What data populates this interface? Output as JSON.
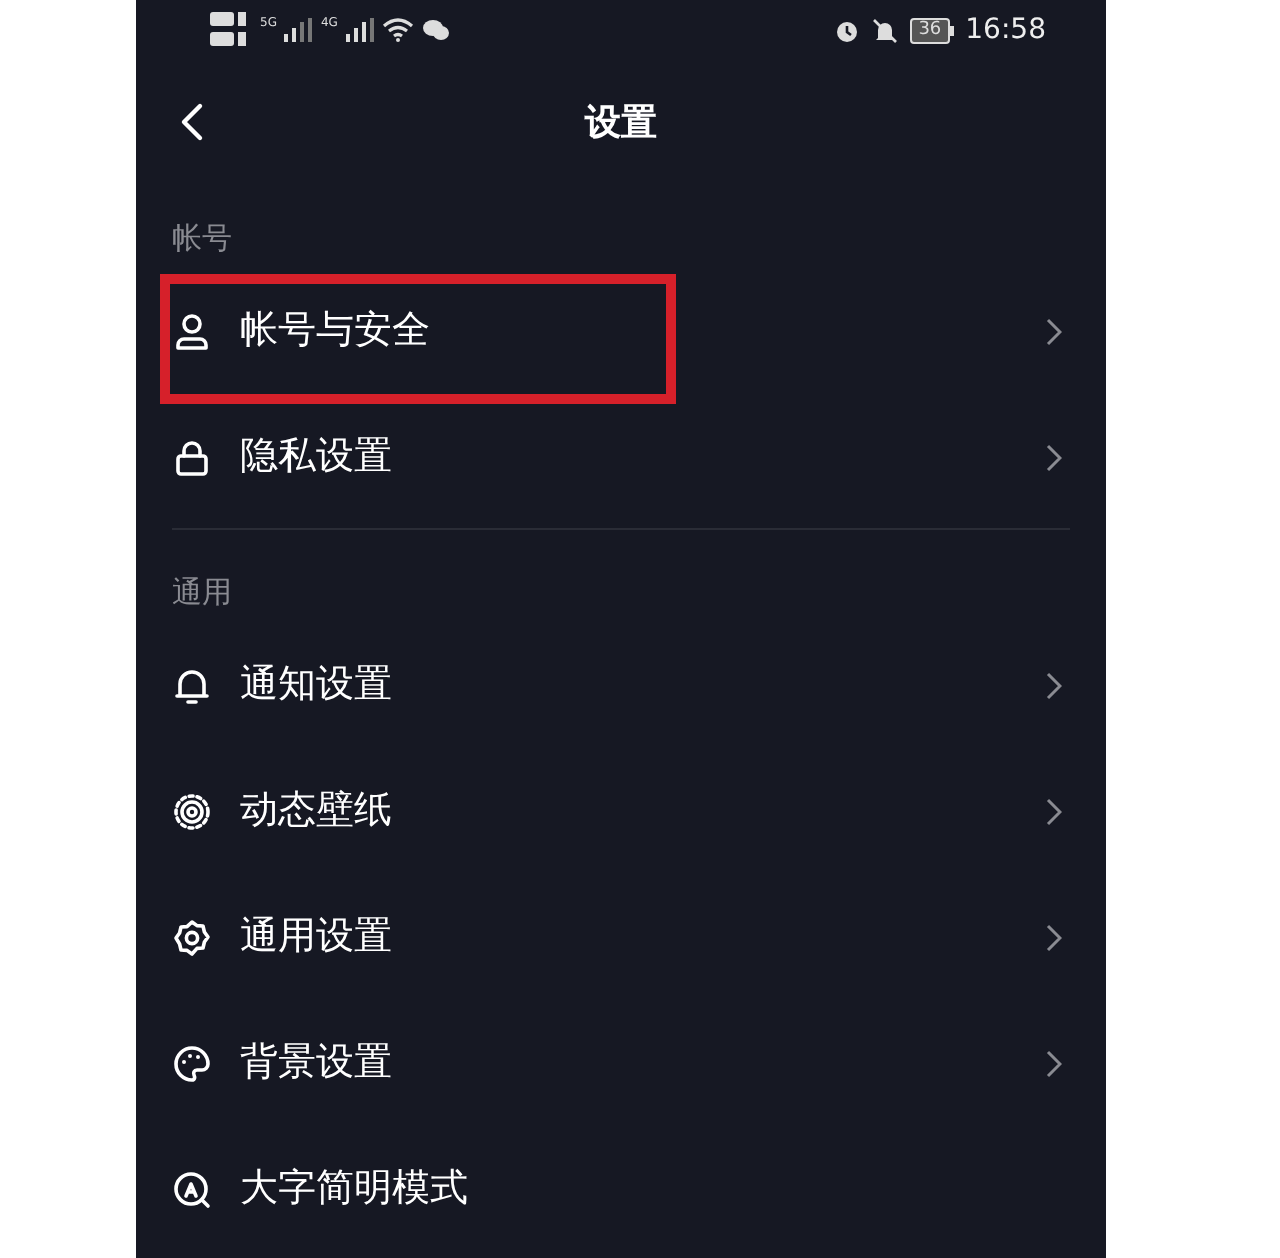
{
  "status_bar": {
    "network_1": "5G",
    "network_2": "4G",
    "battery": "36",
    "time": "16:58"
  },
  "header": {
    "title": "设置"
  },
  "sections": [
    {
      "label": "帐号",
      "items": [
        {
          "label": "帐号与安全",
          "highlighted": true,
          "arrow": true
        },
        {
          "label": "隐私设置",
          "highlighted": false,
          "arrow": true
        }
      ]
    },
    {
      "label": "通用",
      "items": [
        {
          "label": "通知设置",
          "highlighted": false,
          "arrow": true
        },
        {
          "label": "动态壁纸",
          "highlighted": false,
          "arrow": true
        },
        {
          "label": "通用设置",
          "highlighted": false,
          "arrow": true
        },
        {
          "label": "背景设置",
          "highlighted": false,
          "arrow": true
        },
        {
          "label": "大字简明模式",
          "highlighted": false,
          "arrow": false
        }
      ]
    }
  ]
}
